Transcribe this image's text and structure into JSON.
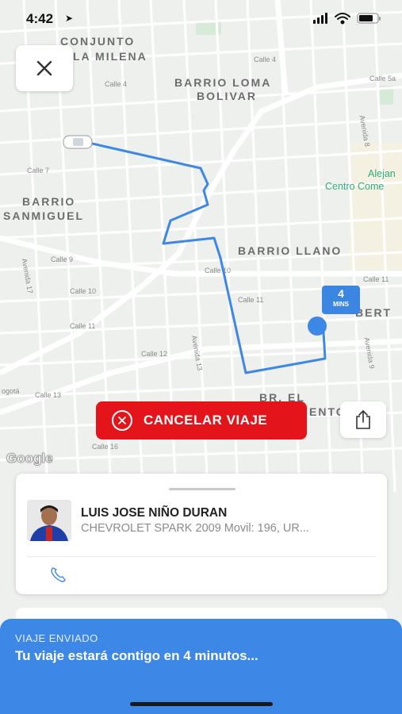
{
  "status_bar": {
    "time": "4:42"
  },
  "map": {
    "labels": {
      "conjunto_line1": "CONJUNTO",
      "conjunto_line2": "LA MILENA",
      "loma_line1": "BARRIO LOMA",
      "loma_line2": "BOLIVAR",
      "sanmiguel_line1": "BARRIO",
      "sanmiguel_line2": "SANMIGUEL",
      "llano": "BARRIO LLANO",
      "libertad_partial": "BERT",
      "br_el": "BR. EL",
      "br_el_line2": "ENTO",
      "alejan": "Alejan",
      "centro": "Centro Come"
    },
    "streets": {
      "calle4a": "Calle 4",
      "calle4b": "Calle 4",
      "calle5a": "Calle 5a",
      "calle7": "Calle 7",
      "calle9": "Calle 9",
      "calle10a": "Calle 10",
      "calle10b": "Calle 10",
      "calle11a": "Calle 11",
      "calle11b": "Calle 11",
      "calle11c": "Calle 11",
      "calle12": "Calle 12",
      "calle13": "Calle 13",
      "calle16": "Calle 16",
      "av17": "Avenida 17",
      "av13": "Avenida 13",
      "av8": "Avenida 8",
      "av9": "Avenida 9",
      "bogota": "ogotá"
    },
    "eta": {
      "value": "4",
      "unit": "MINS"
    },
    "attribution": "Google"
  },
  "actions": {
    "cancel_label": "CANCELAR VIAJE"
  },
  "driver": {
    "name": "LUIS JOSE NIÑO DURAN",
    "vehicle": "CHEVROLET SPARK 2009 Movil: 196, UR..."
  },
  "banner": {
    "status": "VIAJE ENVIADO",
    "message": "Tu viaje estará contigo en 4 minutos..."
  },
  "colors": {
    "route": "#3d88e6",
    "cancel": "#e3151b",
    "banner": "#3d88e6"
  }
}
